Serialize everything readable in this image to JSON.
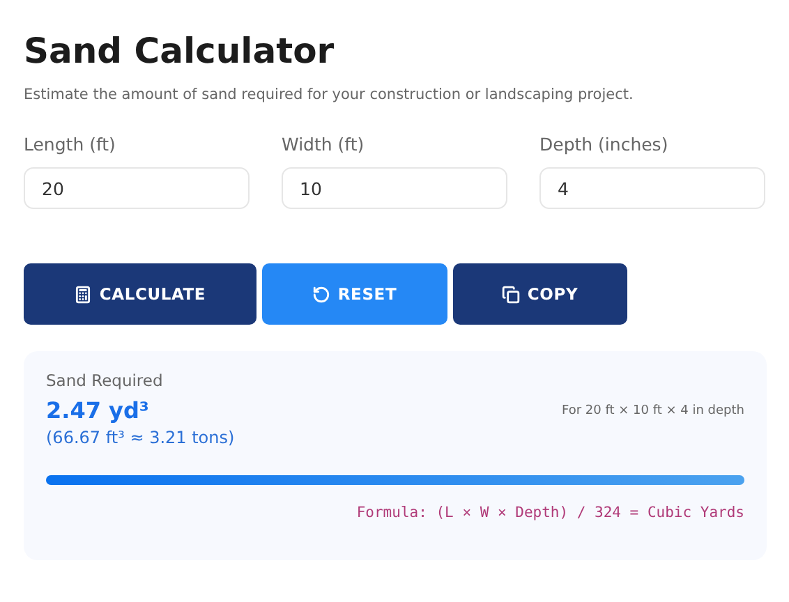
{
  "title": "Sand Calculator",
  "subtitle": "Estimate the amount of sand required for your construction or landscaping project.",
  "fields": [
    {
      "label": "Length (ft)",
      "value": "20"
    },
    {
      "label": "Width (ft)",
      "value": "10"
    },
    {
      "label": "Depth (inches)",
      "value": "4"
    }
  ],
  "buttons": [
    {
      "label": "CALCULATE",
      "kind": "calculate"
    },
    {
      "label": "RESET",
      "kind": "reset"
    },
    {
      "label": "COPY",
      "kind": "copy"
    }
  ],
  "result": {
    "label": "Sand Required",
    "value": "2.47 yd³",
    "dimensions": "For 20 ft × 10 ft × 4 in depth",
    "detail": "(66.67 ft³ ≈ 3.21 tons)",
    "level": 1,
    "formula": "Formula: (L × W × Depth) / 324 = Cubic Yards"
  }
}
